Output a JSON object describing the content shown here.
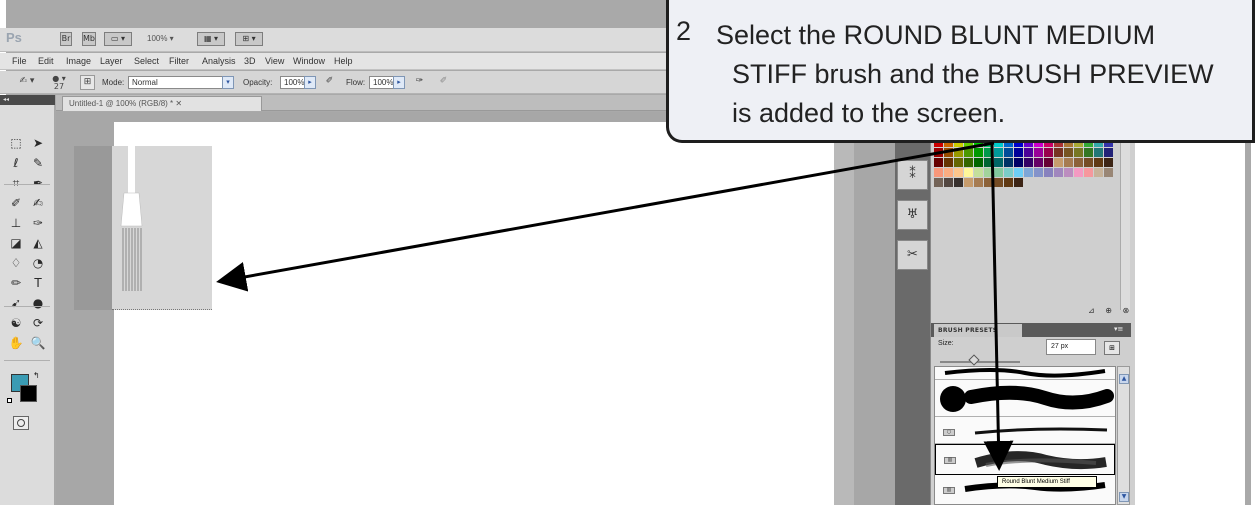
{
  "app": {
    "logo": "Ps",
    "appbar": {
      "icons": [
        "Br",
        "Mb",
        "▭ ▾"
      ],
      "zoom": "100% ▾",
      "view_icons": [
        "▦ ▾",
        "⊞ ▾"
      ]
    },
    "menu": [
      "File",
      "Edit",
      "Image",
      "Layer",
      "Select",
      "Filter",
      "Analysis",
      "3D",
      "View",
      "Window",
      "Help"
    ],
    "options": {
      "brush_size_hint": "27",
      "mode_label": "Mode:",
      "mode_value": "Normal",
      "opacity_label": "Opacity:",
      "opacity_value": "100%",
      "flow_label": "Flow:",
      "flow_value": "100%"
    },
    "tools_header": "◂◂",
    "document_tab": "Untitled-1 @ 100% (RGB/8) * ✕",
    "tools": [
      {
        "name": "marquee-tool",
        "glyph": "⬚"
      },
      {
        "name": "move-tool",
        "glyph": "➤"
      },
      {
        "name": "lasso-tool",
        "glyph": "ℓ"
      },
      {
        "name": "quick-selection-tool",
        "glyph": "✎"
      },
      {
        "name": "crop-tool",
        "glyph": "⌗"
      },
      {
        "name": "eyedropper-tool",
        "glyph": "✒"
      },
      {
        "name": "spot-healing-tool",
        "glyph": "✐"
      },
      {
        "name": "brush-tool",
        "glyph": "✍"
      },
      {
        "name": "clone-stamp-tool",
        "glyph": "⊥"
      },
      {
        "name": "history-brush-tool",
        "glyph": "✑"
      },
      {
        "name": "eraser-tool",
        "glyph": "◪"
      },
      {
        "name": "gradient-tool",
        "glyph": "◭"
      },
      {
        "name": "blur-tool",
        "glyph": "♢"
      },
      {
        "name": "dodge-tool",
        "glyph": "◔"
      },
      {
        "name": "pen-tool",
        "glyph": "✏"
      },
      {
        "name": "type-tool",
        "glyph": "T"
      },
      {
        "name": "path-selection-tool",
        "glyph": "➹"
      },
      {
        "name": "shape-tool",
        "glyph": "●"
      },
      {
        "name": "3d-rotate-tool",
        "glyph": "☯"
      },
      {
        "name": "3d-orbit-tool",
        "glyph": "⟳"
      },
      {
        "name": "hand-tool",
        "glyph": "✋"
      },
      {
        "name": "zoom-tool",
        "glyph": "🔍"
      }
    ],
    "dock_icons": [
      "⁑",
      "♅",
      "✂"
    ],
    "brush_presets": {
      "tab_label": "BRUSH PRESETS",
      "menu": "▾≡",
      "size_label": "Size:",
      "size_value": "27 px",
      "tooltip": "Round Blunt Medium Stiff"
    },
    "colors": {
      "foreground": "#3a9bb3",
      "background": "#000000"
    }
  },
  "callout": {
    "number": "2",
    "text": "Select the ROUND BLUNT MEDIUM STIFF brush and the BRUSH PREVIEW is added to the screen."
  }
}
